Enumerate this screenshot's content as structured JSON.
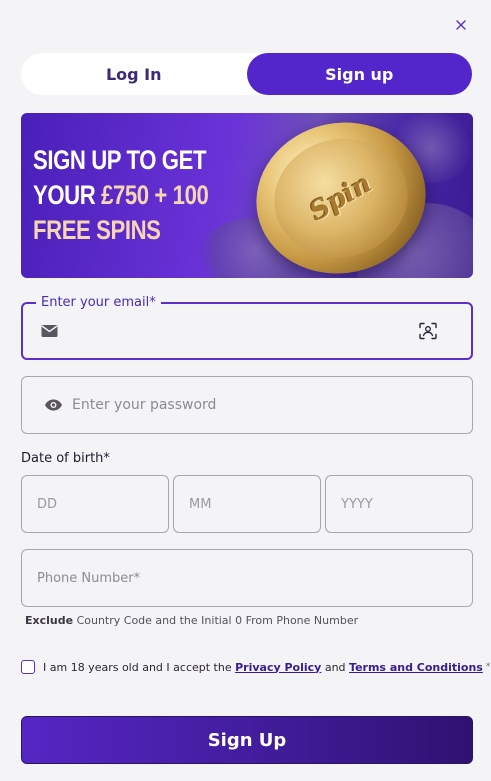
{
  "tabs": {
    "login_label": "Log In",
    "signup_label": "Sign up"
  },
  "banner": {
    "line1": "SIGN UP TO GET",
    "line2_white": "YOUR ",
    "line2_gold": "£750 + 100",
    "line3": "FREE SPINS"
  },
  "email": {
    "label": "Enter your email*",
    "value": ""
  },
  "password": {
    "placeholder": "Enter your password"
  },
  "dob": {
    "label": "Date of birth*",
    "day_placeholder": "DD",
    "month_placeholder": "MM",
    "year_placeholder": "YYYY"
  },
  "phone": {
    "placeholder": "Phone Number*",
    "hint_bold": "Exclude",
    "hint_rest": " Country Code and the Initial 0 From Phone Number"
  },
  "terms": {
    "prefix": "I am 18 years old and I accept the ",
    "privacy_link": "Privacy Policy",
    "middle": " and ",
    "terms_link": "Terms and Conditions",
    "required_mark": "*"
  },
  "submit_label": "Sign Up",
  "colors": {
    "accent": "#5326cc",
    "focus_border": "#5b2fc9",
    "banner_gold": "#f6d6b2",
    "background": "#f4f3f5"
  },
  "icons": {
    "close": "close-icon",
    "email": "envelope-icon",
    "autofill": "contact-card-icon",
    "password": "eye-icon"
  }
}
